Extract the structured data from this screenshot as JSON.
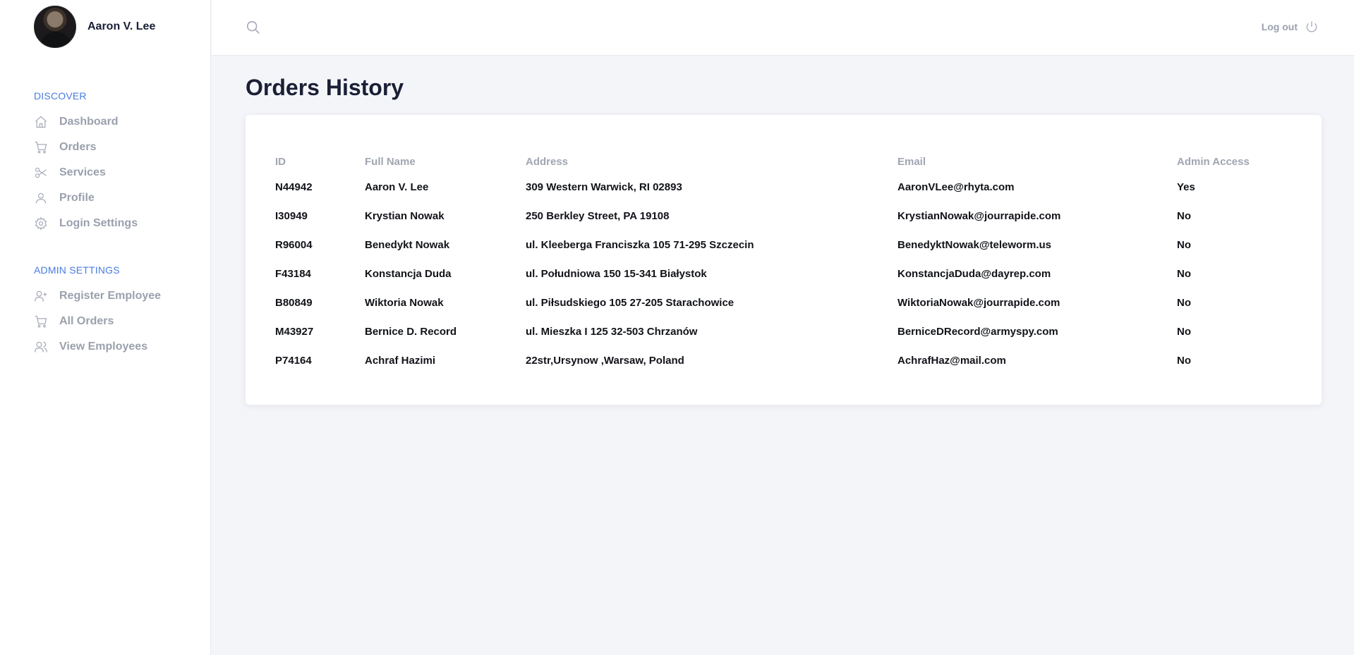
{
  "user": {
    "name": "Aaron V. Lee"
  },
  "sidebar": {
    "discover_title": "DISCOVER",
    "discover_items": [
      {
        "label": "Dashboard",
        "icon": "home-icon"
      },
      {
        "label": "Orders",
        "icon": "cart-icon"
      },
      {
        "label": "Services",
        "icon": "scissors-icon"
      },
      {
        "label": "Profile",
        "icon": "user-icon"
      },
      {
        "label": "Login Settings",
        "icon": "gear-icon"
      }
    ],
    "admin_title": "ADMIN SETTINGS",
    "admin_items": [
      {
        "label": "Register Employee",
        "icon": "user-plus-icon"
      },
      {
        "label": "All Orders",
        "icon": "cart-icon"
      },
      {
        "label": "View Employees",
        "icon": "users-icon"
      }
    ]
  },
  "topbar": {
    "logout_label": "Log out"
  },
  "page": {
    "title": "Orders History"
  },
  "table": {
    "headers": [
      "ID",
      "Full Name",
      "Address",
      "Email",
      "Admin Access"
    ],
    "rows": [
      [
        "N44942",
        "Aaron V. Lee",
        "309 Western Warwick, RI 02893",
        "AaronVLee@rhyta.com",
        "Yes"
      ],
      [
        "I30949",
        "Krystian Nowak",
        "250 Berkley Street, PA 19108",
        "KrystianNowak@jourrapide.com",
        "No"
      ],
      [
        "R96004",
        "Benedykt Nowak",
        "ul. Kleeberga Franciszka 105 71-295 Szczecin",
        "BenedyktNowak@teleworm.us",
        "No"
      ],
      [
        "F43184",
        "Konstancja Duda",
        "ul. Południowa 150 15-341 Białystok",
        "KonstancjaDuda@dayrep.com",
        "No"
      ],
      [
        "B80849",
        "Wiktoria Nowak",
        "ul. Piłsudskiego 105 27-205 Starachowice",
        "WiktoriaNowak@jourrapide.com",
        "No"
      ],
      [
        "M43927",
        "Bernice D. Record",
        "ul. Mieszka I 125 32-503 Chrzanów",
        "BerniceDRecord@armyspy.com",
        "No"
      ],
      [
        "P74164",
        "Achraf Hazimi",
        "22str,Ursynow ,Warsaw, Poland",
        "AchrafHaz@mail.com",
        "No"
      ]
    ]
  },
  "colors": {
    "accent": "#4a7be0",
    "muted": "#9aa0ad",
    "text": "#1a1f36",
    "background": "#f4f5f9"
  }
}
